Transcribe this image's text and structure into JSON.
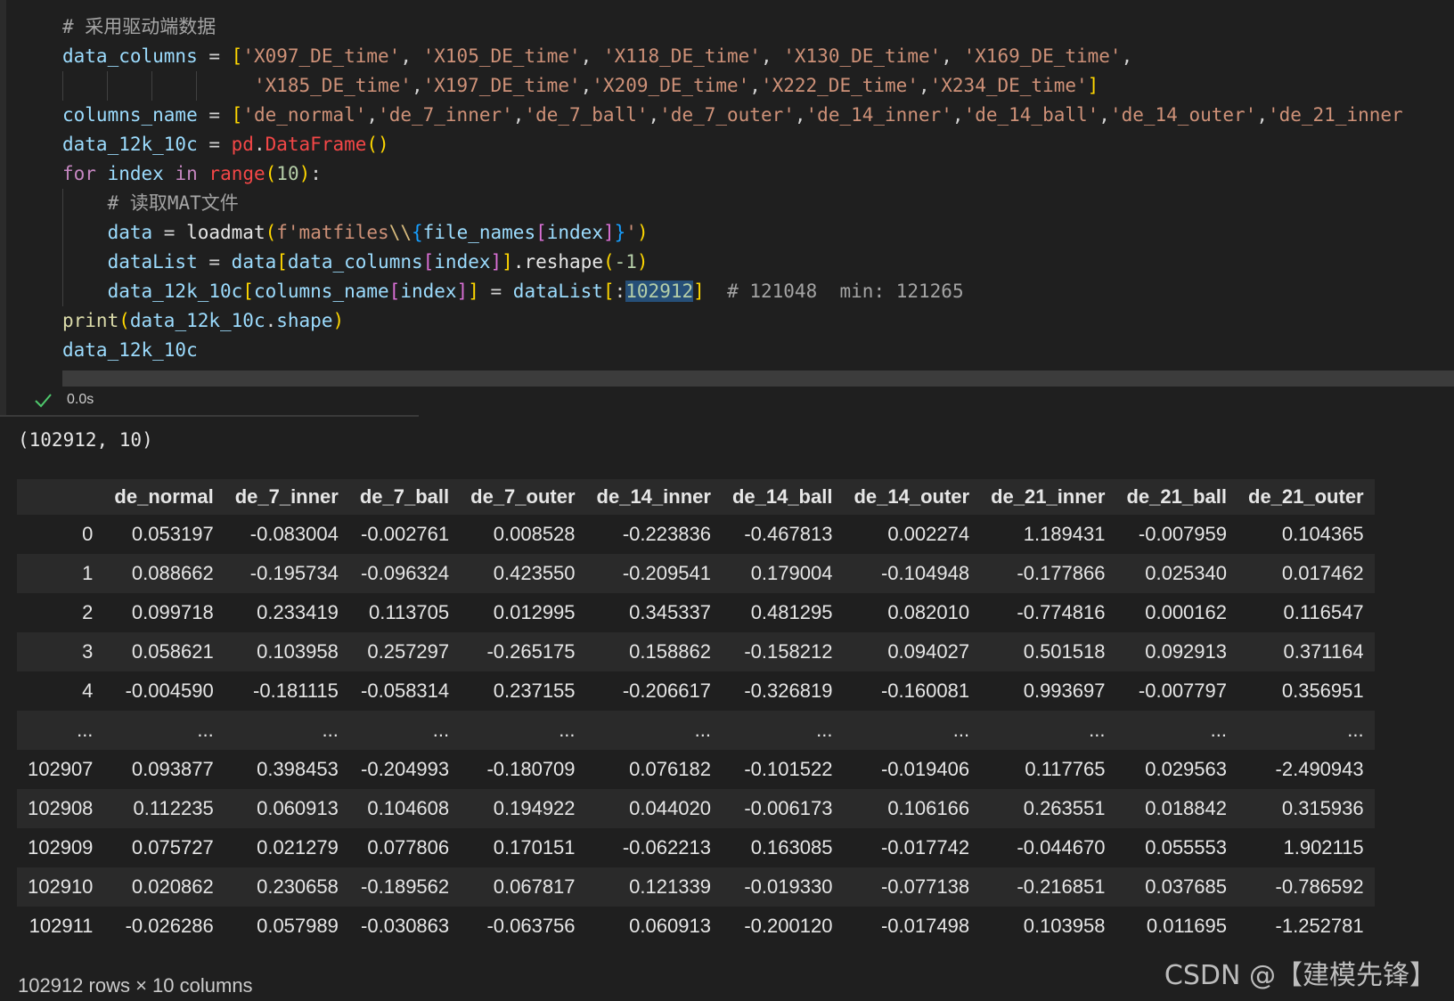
{
  "code_lines": [
    {
      "indent": 0,
      "segments": [
        [
          "c-comment",
          "# 采用驱动端数据"
        ]
      ]
    },
    {
      "indent": 0,
      "segments": [
        [
          "c-var2",
          "data_columns"
        ],
        [
          "c-op",
          " = "
        ],
        [
          "c-br",
          "["
        ],
        [
          "c-str",
          "'X097_DE_time'"
        ],
        [
          "c-op",
          ", "
        ],
        [
          "c-str",
          "'X105_DE_time'"
        ],
        [
          "c-op",
          ", "
        ],
        [
          "c-str",
          "'X118_DE_time'"
        ],
        [
          "c-op",
          ", "
        ],
        [
          "c-str",
          "'X130_DE_time'"
        ],
        [
          "c-op",
          ", "
        ],
        [
          "c-str",
          "'X169_DE_time'"
        ],
        [
          "c-op",
          ","
        ]
      ]
    },
    {
      "indent": 0,
      "guides": 4,
      "segments": [
        [
          "c-op",
          "                 "
        ],
        [
          "c-str",
          "'X185_DE_time'"
        ],
        [
          "c-op",
          ","
        ],
        [
          "c-str",
          "'X197_DE_time'"
        ],
        [
          "c-op",
          ","
        ],
        [
          "c-str",
          "'X209_DE_time'"
        ],
        [
          "c-op",
          ","
        ],
        [
          "c-str",
          "'X222_DE_time'"
        ],
        [
          "c-op",
          ","
        ],
        [
          "c-str",
          "'X234_DE_time'"
        ],
        [
          "c-br",
          "]"
        ]
      ]
    },
    {
      "indent": 0,
      "segments": [
        [
          "c-var2",
          "columns_name"
        ],
        [
          "c-op",
          " = "
        ],
        [
          "c-br",
          "["
        ],
        [
          "c-str",
          "'de_normal'"
        ],
        [
          "c-op",
          ","
        ],
        [
          "c-str",
          "'de_7_inner'"
        ],
        [
          "c-op",
          ","
        ],
        [
          "c-str",
          "'de_7_ball'"
        ],
        [
          "c-op",
          ","
        ],
        [
          "c-str",
          "'de_7_outer'"
        ],
        [
          "c-op",
          ","
        ],
        [
          "c-str",
          "'de_14_inner'"
        ],
        [
          "c-op",
          ","
        ],
        [
          "c-str",
          "'de_14_ball'"
        ],
        [
          "c-op",
          ","
        ],
        [
          "c-str",
          "'de_14_outer'"
        ],
        [
          "c-op",
          ","
        ],
        [
          "c-str",
          "'de_21_inner"
        ]
      ]
    },
    {
      "indent": 0,
      "segments": [
        [
          "c-var2",
          "data_12k_10c"
        ],
        [
          "c-op",
          " = "
        ],
        [
          "c-red",
          "pd"
        ],
        [
          "c-op",
          "."
        ],
        [
          "c-red",
          "DataFrame"
        ],
        [
          "c-br",
          "()"
        ]
      ]
    },
    {
      "indent": 0,
      "segments": [
        [
          "c-kw",
          "for"
        ],
        [
          "c-op",
          " "
        ],
        [
          "c-var2",
          "index"
        ],
        [
          "c-op",
          " "
        ],
        [
          "c-kw",
          "in"
        ],
        [
          "c-op",
          " "
        ],
        [
          "c-red",
          "range"
        ],
        [
          "c-br",
          "("
        ],
        [
          "c-num",
          "10"
        ],
        [
          "c-br",
          ")"
        ],
        [
          "c-op",
          ":"
        ]
      ]
    },
    {
      "indent": 1,
      "segments": [
        [
          "c-comment",
          "# 读取MAT文件"
        ]
      ]
    },
    {
      "indent": 1,
      "segments": [
        [
          "c-var2",
          "data"
        ],
        [
          "c-op",
          " = "
        ],
        [
          "c-white",
          "loadmat"
        ],
        [
          "c-br",
          "("
        ],
        [
          "c-str",
          "f'matfiles"
        ],
        [
          "c-str2",
          "\\\\"
        ],
        [
          "c-br3",
          "{"
        ],
        [
          "c-var2",
          "file_names"
        ],
        [
          "c-br2",
          "["
        ],
        [
          "c-var2",
          "index"
        ],
        [
          "c-br2",
          "]"
        ],
        [
          "c-br3",
          "}"
        ],
        [
          "c-str",
          "'"
        ],
        [
          "c-br",
          ")"
        ]
      ]
    },
    {
      "indent": 1,
      "segments": [
        [
          "c-var2",
          "dataList"
        ],
        [
          "c-op",
          " = "
        ],
        [
          "c-var2",
          "data"
        ],
        [
          "c-br",
          "["
        ],
        [
          "c-var2",
          "data_columns"
        ],
        [
          "c-br2",
          "["
        ],
        [
          "c-var2",
          "index"
        ],
        [
          "c-br2",
          "]"
        ],
        [
          "c-br",
          "]"
        ],
        [
          "c-white",
          ".reshape"
        ],
        [
          "c-br",
          "("
        ],
        [
          "c-num",
          "-1"
        ],
        [
          "c-br",
          ")"
        ]
      ]
    },
    {
      "indent": 1,
      "segments": [
        [
          "c-var2",
          "data_12k_10c"
        ],
        [
          "c-br",
          "["
        ],
        [
          "c-var2",
          "columns_name"
        ],
        [
          "c-br2",
          "["
        ],
        [
          "c-var2",
          "index"
        ],
        [
          "c-br2",
          "]"
        ],
        [
          "c-br",
          "]"
        ],
        [
          "c-op",
          " = "
        ],
        [
          "c-var2",
          "dataList"
        ],
        [
          "c-br",
          "["
        ],
        [
          "c-op",
          ":"
        ],
        [
          "highlight",
          "102912"
        ],
        [
          "c-br",
          "]"
        ],
        [
          "c-op",
          "  "
        ],
        [
          "c-comment",
          "# 121048  min: 121265"
        ]
      ]
    },
    {
      "indent": 0,
      "segments": [
        [
          "c-fn",
          "print"
        ],
        [
          "c-br",
          "("
        ],
        [
          "c-var2",
          "data_12k_10c"
        ],
        [
          "c-op",
          "."
        ],
        [
          "c-var2",
          "shape"
        ],
        [
          "c-br",
          ")"
        ]
      ]
    },
    {
      "indent": 0,
      "segments": [
        [
          "c-var2",
          "data_12k_10c"
        ]
      ]
    }
  ],
  "status": {
    "time": "0.0s"
  },
  "shape_output": "(102912, 10)",
  "table": {
    "columns": [
      "",
      "de_normal",
      "de_7_inner",
      "de_7_ball",
      "de_7_outer",
      "de_14_inner",
      "de_14_ball",
      "de_14_outer",
      "de_21_inner",
      "de_21_ball",
      "de_21_outer"
    ],
    "rows": [
      [
        "0",
        "0.053197",
        "-0.083004",
        "-0.002761",
        "0.008528",
        "-0.223836",
        "-0.467813",
        "0.002274",
        "1.189431",
        "-0.007959",
        "0.104365"
      ],
      [
        "1",
        "0.088662",
        "-0.195734",
        "-0.096324",
        "0.423550",
        "-0.209541",
        "0.179004",
        "-0.104948",
        "-0.177866",
        "0.025340",
        "0.017462"
      ],
      [
        "2",
        "0.099718",
        "0.233419",
        "0.113705",
        "0.012995",
        "0.345337",
        "0.481295",
        "0.082010",
        "-0.774816",
        "0.000162",
        "0.116547"
      ],
      [
        "3",
        "0.058621",
        "0.103958",
        "0.257297",
        "-0.265175",
        "0.158862",
        "-0.158212",
        "0.094027",
        "0.501518",
        "0.092913",
        "0.371164"
      ],
      [
        "4",
        "-0.004590",
        "-0.181115",
        "-0.058314",
        "0.237155",
        "-0.206617",
        "-0.326819",
        "-0.160081",
        "0.993697",
        "-0.007797",
        "0.356951"
      ],
      [
        "...",
        "...",
        "...",
        "...",
        "...",
        "...",
        "...",
        "...",
        "...",
        "...",
        "..."
      ],
      [
        "102907",
        "0.093877",
        "0.398453",
        "-0.204993",
        "-0.180709",
        "0.076182",
        "-0.101522",
        "-0.019406",
        "0.117765",
        "0.029563",
        "-2.490943"
      ],
      [
        "102908",
        "0.112235",
        "0.060913",
        "0.104608",
        "0.194922",
        "0.044020",
        "-0.006173",
        "0.106166",
        "0.263551",
        "0.018842",
        "0.315936"
      ],
      [
        "102909",
        "0.075727",
        "0.021279",
        "0.077806",
        "0.170151",
        "-0.062213",
        "0.163085",
        "-0.017742",
        "-0.044670",
        "0.055553",
        "1.902115"
      ],
      [
        "102910",
        "0.020862",
        "0.230658",
        "-0.189562",
        "0.067817",
        "0.121339",
        "-0.019330",
        "-0.077138",
        "-0.216851",
        "0.037685",
        "-0.786592"
      ],
      [
        "102911",
        "-0.026286",
        "0.057989",
        "-0.030863",
        "-0.063756",
        "0.060913",
        "-0.200120",
        "-0.017498",
        "0.103958",
        "0.011695",
        "-1.252781"
      ]
    ]
  },
  "rows_cols": "102912 rows × 10 columns",
  "watermark": "CSDN @【建模先锋】"
}
